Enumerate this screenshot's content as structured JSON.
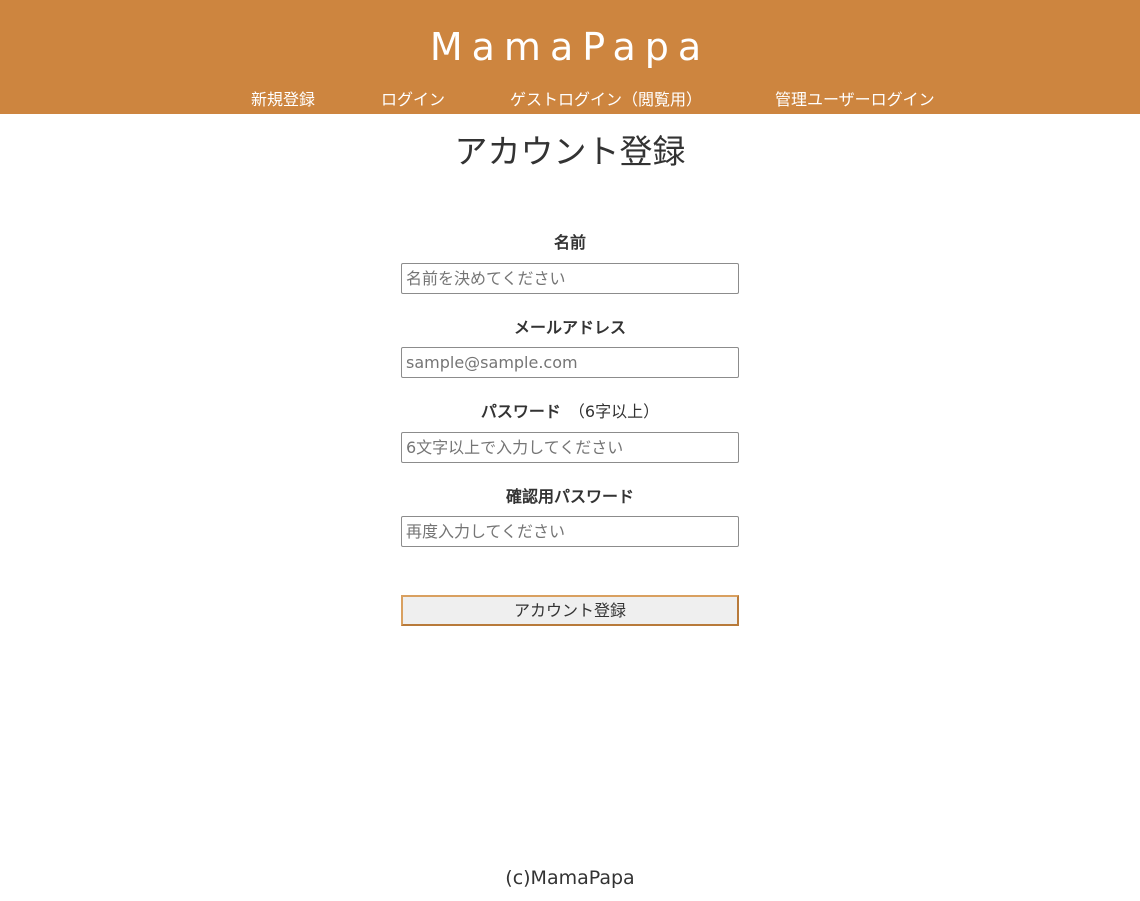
{
  "header": {
    "logo": "MamaPapa",
    "nav": [
      {
        "label": "新規登録"
      },
      {
        "label": "ログイン"
      },
      {
        "label": "ゲストログイン（閲覧用）"
      },
      {
        "label": "管理ユーザーログイン"
      }
    ],
    "background_color": "#cd853f"
  },
  "main": {
    "title": "アカウント登録",
    "fields": [
      {
        "label": "名前",
        "placeholder": "名前を決めてください",
        "value": ""
      },
      {
        "label": "メールアドレス",
        "placeholder": "sample@sample.com",
        "value": ""
      },
      {
        "label": "パスワード",
        "note": "（6字以上）",
        "placeholder": "6文字以上で入力してください",
        "value": ""
      },
      {
        "label": "確認用パスワード",
        "placeholder": "再度入力してください",
        "value": ""
      }
    ],
    "submit_label": "アカウント登録"
  },
  "footer": {
    "copyright": "(c)MamaPapa"
  }
}
